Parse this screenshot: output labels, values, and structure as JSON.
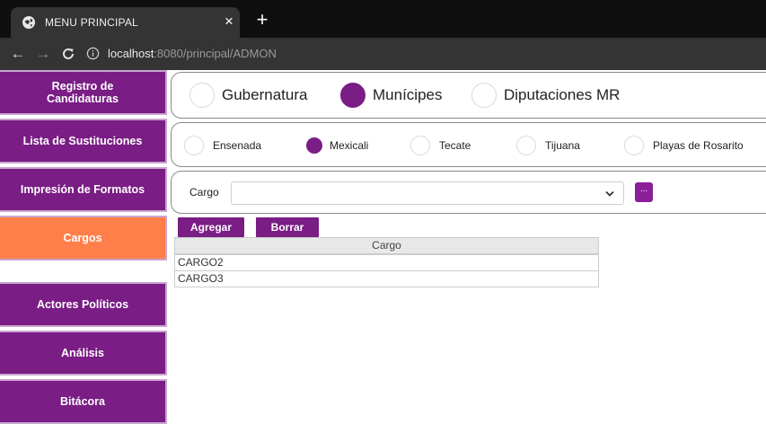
{
  "browser": {
    "tab_title": "MENU PRINCIPAL",
    "tab_close": "×",
    "new_tab": "+",
    "url_host": "localhost",
    "url_rest": ":8080/principal/ADMON"
  },
  "sidebar": {
    "items": [
      {
        "label": "Registro de\nCandidaturas",
        "active": false
      },
      {
        "label": "Lista de Sustituciones",
        "active": false
      },
      {
        "label": "Impresión de Formatos",
        "active": false
      },
      {
        "label": "Cargos",
        "active": true
      },
      {
        "label": "Actores Políticos",
        "active": false
      },
      {
        "label": "Análisis",
        "active": false
      },
      {
        "label": "Bitácora",
        "active": false
      }
    ]
  },
  "election_types": {
    "options": [
      "Gubernatura",
      "Munícipes",
      "Diputaciones MR"
    ],
    "selected": "Munícipes"
  },
  "municipalities": {
    "options": [
      "Ensenada",
      "Mexicali",
      "Tecate",
      "Tijuana",
      "Playas de Rosarito"
    ],
    "selected": "Mexicali"
  },
  "cargo_filter": {
    "label": "Cargo",
    "value": "",
    "button_label": "..."
  },
  "actions": {
    "add_label": "Agregar",
    "delete_label": "Borrar"
  },
  "grid": {
    "header": "Cargo",
    "rows": [
      "CARGO2",
      "CARGO3"
    ]
  },
  "colors": {
    "brand_purple": "#7a1d85",
    "active_orange": "#ff7f4a"
  }
}
